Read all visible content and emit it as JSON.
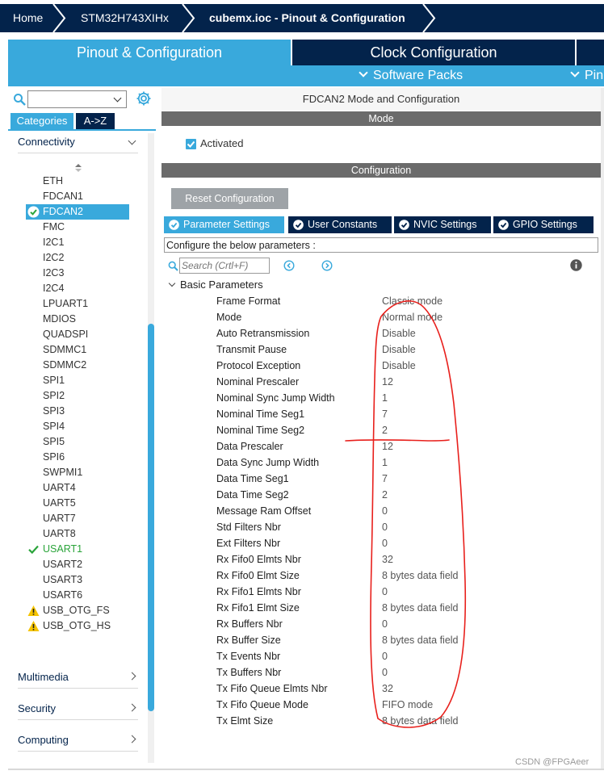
{
  "breadcrumb": {
    "home": "Home",
    "device": "STM32H743XIHx",
    "file": "cubemx.ioc - Pinout & Configuration"
  },
  "tabs": {
    "pinout": "Pinout & Configuration",
    "clock": "Clock Configuration",
    "software_packs": "Software Packs",
    "pinout_view": "Pin"
  },
  "left_panel": {
    "search_placeholder": "",
    "category_tabs": [
      "Categories",
      "A->Z"
    ],
    "sections": {
      "connectivity": "Connectivity",
      "multimedia": "Multimedia",
      "security": "Security",
      "computing": "Computing"
    },
    "peripherals": [
      {
        "name": "ETH",
        "status": "none"
      },
      {
        "name": "FDCAN1",
        "status": "none"
      },
      {
        "name": "FDCAN2",
        "status": "selected"
      },
      {
        "name": "FMC",
        "status": "none"
      },
      {
        "name": "I2C1",
        "status": "none"
      },
      {
        "name": "I2C2",
        "status": "none"
      },
      {
        "name": "I2C3",
        "status": "none"
      },
      {
        "name": "I2C4",
        "status": "none"
      },
      {
        "name": "LPUART1",
        "status": "none"
      },
      {
        "name": "MDIOS",
        "status": "none"
      },
      {
        "name": "QUADSPI",
        "status": "none"
      },
      {
        "name": "SDMMC1",
        "status": "none"
      },
      {
        "name": "SDMMC2",
        "status": "none"
      },
      {
        "name": "SPI1",
        "status": "none"
      },
      {
        "name": "SPI2",
        "status": "none"
      },
      {
        "name": "SPI3",
        "status": "none"
      },
      {
        "name": "SPI4",
        "status": "none"
      },
      {
        "name": "SPI5",
        "status": "none"
      },
      {
        "name": "SPI6",
        "status": "none"
      },
      {
        "name": "SWPMI1",
        "status": "none"
      },
      {
        "name": "UART4",
        "status": "none"
      },
      {
        "name": "UART5",
        "status": "none"
      },
      {
        "name": "UART7",
        "status": "none"
      },
      {
        "name": "UART8",
        "status": "none"
      },
      {
        "name": "USART1",
        "status": "ok"
      },
      {
        "name": "USART2",
        "status": "none"
      },
      {
        "name": "USART3",
        "status": "none"
      },
      {
        "name": "USART6",
        "status": "none"
      },
      {
        "name": "USB_OTG_FS",
        "status": "warning"
      },
      {
        "name": "USB_OTG_HS",
        "status": "warning"
      }
    ]
  },
  "right_panel": {
    "title": "FDCAN2 Mode and Configuration",
    "mode_header": "Mode",
    "activated_label": "Activated",
    "config_header": "Configuration",
    "reset_button": "Reset Configuration",
    "param_tabs": [
      "Parameter Settings",
      "User Constants",
      "NVIC Settings",
      "GPIO Settings"
    ],
    "configure_label": "Configure the below parameters :",
    "search_placeholder": "Search (Crtl+F)",
    "group": "Basic Parameters",
    "params": [
      {
        "name": "Frame Format",
        "value": "Classic mode"
      },
      {
        "name": "Mode",
        "value": "Normal mode"
      },
      {
        "name": "Auto Retransmission",
        "value": "Disable"
      },
      {
        "name": "Transmit Pause",
        "value": "Disable"
      },
      {
        "name": "Protocol Exception",
        "value": "Disable"
      },
      {
        "name": "Nominal Prescaler",
        "value": "12"
      },
      {
        "name": "Nominal Sync Jump Width",
        "value": "1"
      },
      {
        "name": "Nominal Time Seg1",
        "value": "7"
      },
      {
        "name": "Nominal Time Seg2",
        "value": "2"
      },
      {
        "name": "Data Prescaler",
        "value": "12"
      },
      {
        "name": "Data Sync Jump Width",
        "value": "1"
      },
      {
        "name": "Data Time Seg1",
        "value": "7"
      },
      {
        "name": "Data Time Seg2",
        "value": "2"
      },
      {
        "name": "Message Ram Offset",
        "value": "0"
      },
      {
        "name": "Std Filters Nbr",
        "value": "0"
      },
      {
        "name": "Ext Filters Nbr",
        "value": "0"
      },
      {
        "name": "Rx Fifo0 Elmts Nbr",
        "value": "32"
      },
      {
        "name": "Rx Fifo0 Elmt Size",
        "value": "8 bytes data field"
      },
      {
        "name": "Rx Fifo1 Elmts Nbr",
        "value": "0"
      },
      {
        "name": "Rx Fifo1 Elmt Size",
        "value": "8 bytes data field"
      },
      {
        "name": "Rx Buffers Nbr",
        "value": "0"
      },
      {
        "name": "Rx Buffer Size",
        "value": "8 bytes data field"
      },
      {
        "name": "Tx Events Nbr",
        "value": "0"
      },
      {
        "name": "Tx Buffers Nbr",
        "value": "0"
      },
      {
        "name": "Tx Fifo Queue Elmts Nbr",
        "value": "32"
      },
      {
        "name": "Tx Fifo Queue Mode",
        "value": "FIFO mode"
      },
      {
        "name": "Tx Elmt Size",
        "value": "8 bytes data field"
      }
    ]
  },
  "watermark": "CSDN @FPGAeer",
  "colors": {
    "navy": "#03234b",
    "accent": "#39a9dc",
    "ok": "#2aa43a",
    "warning": "#f5c400",
    "annotation": "#e8201c"
  }
}
